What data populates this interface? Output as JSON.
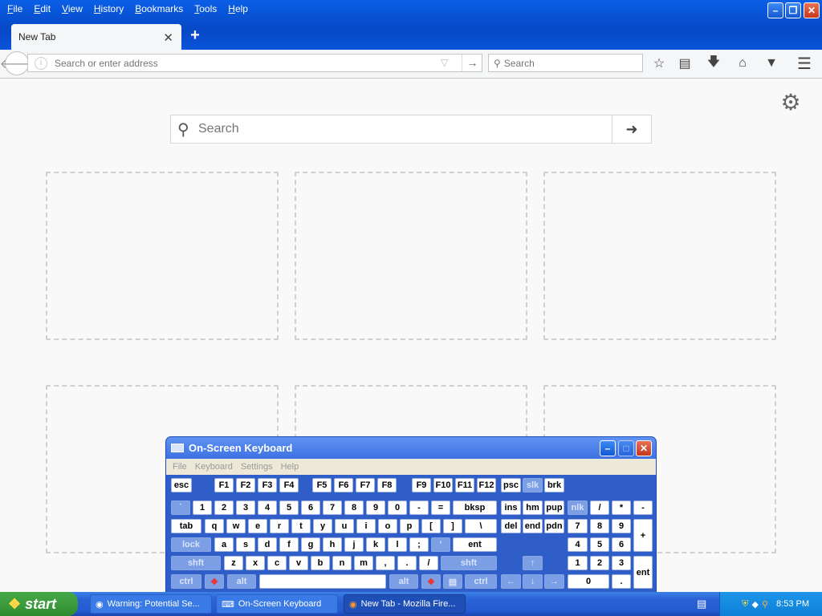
{
  "window": {
    "menu": [
      "File",
      "Edit",
      "View",
      "History",
      "Bookmarks",
      "Tools",
      "Help"
    ],
    "tab_title": "New Tab"
  },
  "navbar": {
    "url_placeholder": "Search or enter address",
    "search_placeholder": "Search"
  },
  "content": {
    "search_placeholder": "Search"
  },
  "osk": {
    "title": "On-Screen Keyboard",
    "menu": [
      "File",
      "Keyboard",
      "Settings",
      "Help"
    ],
    "rows": {
      "fn": [
        "esc",
        "F1",
        "F2",
        "F3",
        "F4",
        "F5",
        "F6",
        "F7",
        "F8",
        "F9",
        "F10",
        "F11",
        "F12",
        "psc",
        "slk",
        "brk"
      ],
      "num": [
        "`",
        "1",
        "2",
        "3",
        "4",
        "5",
        "6",
        "7",
        "8",
        "9",
        "0",
        "-",
        "=",
        "bksp",
        "ins",
        "hm",
        "pup",
        "nlk",
        "/",
        "*",
        "-"
      ],
      "tab": [
        "tab",
        "q",
        "w",
        "e",
        "r",
        "t",
        "y",
        "u",
        "i",
        "o",
        "p",
        "[",
        "]",
        "\\",
        "del",
        "end",
        "pdn",
        "7",
        "8",
        "9",
        "+"
      ],
      "caps": [
        "lock",
        "a",
        "s",
        "d",
        "f",
        "g",
        "h",
        "j",
        "k",
        "l",
        ";",
        "'",
        "ent",
        "4",
        "5",
        "6"
      ],
      "shift": [
        "shft",
        "z",
        "x",
        "c",
        "v",
        "b",
        "n",
        "m",
        ",",
        ".",
        "/",
        "shft",
        "1",
        "2",
        "3",
        "ent"
      ],
      "ctrl": [
        "ctrl",
        "alt",
        "alt",
        "ctrl",
        "0",
        "."
      ]
    }
  },
  "taskbar": {
    "start": "start",
    "tasks": [
      "Warning: Potential Se...",
      "On-Screen Keyboard",
      "New Tab - Mozilla Fire..."
    ],
    "clock": "8:53 PM"
  }
}
